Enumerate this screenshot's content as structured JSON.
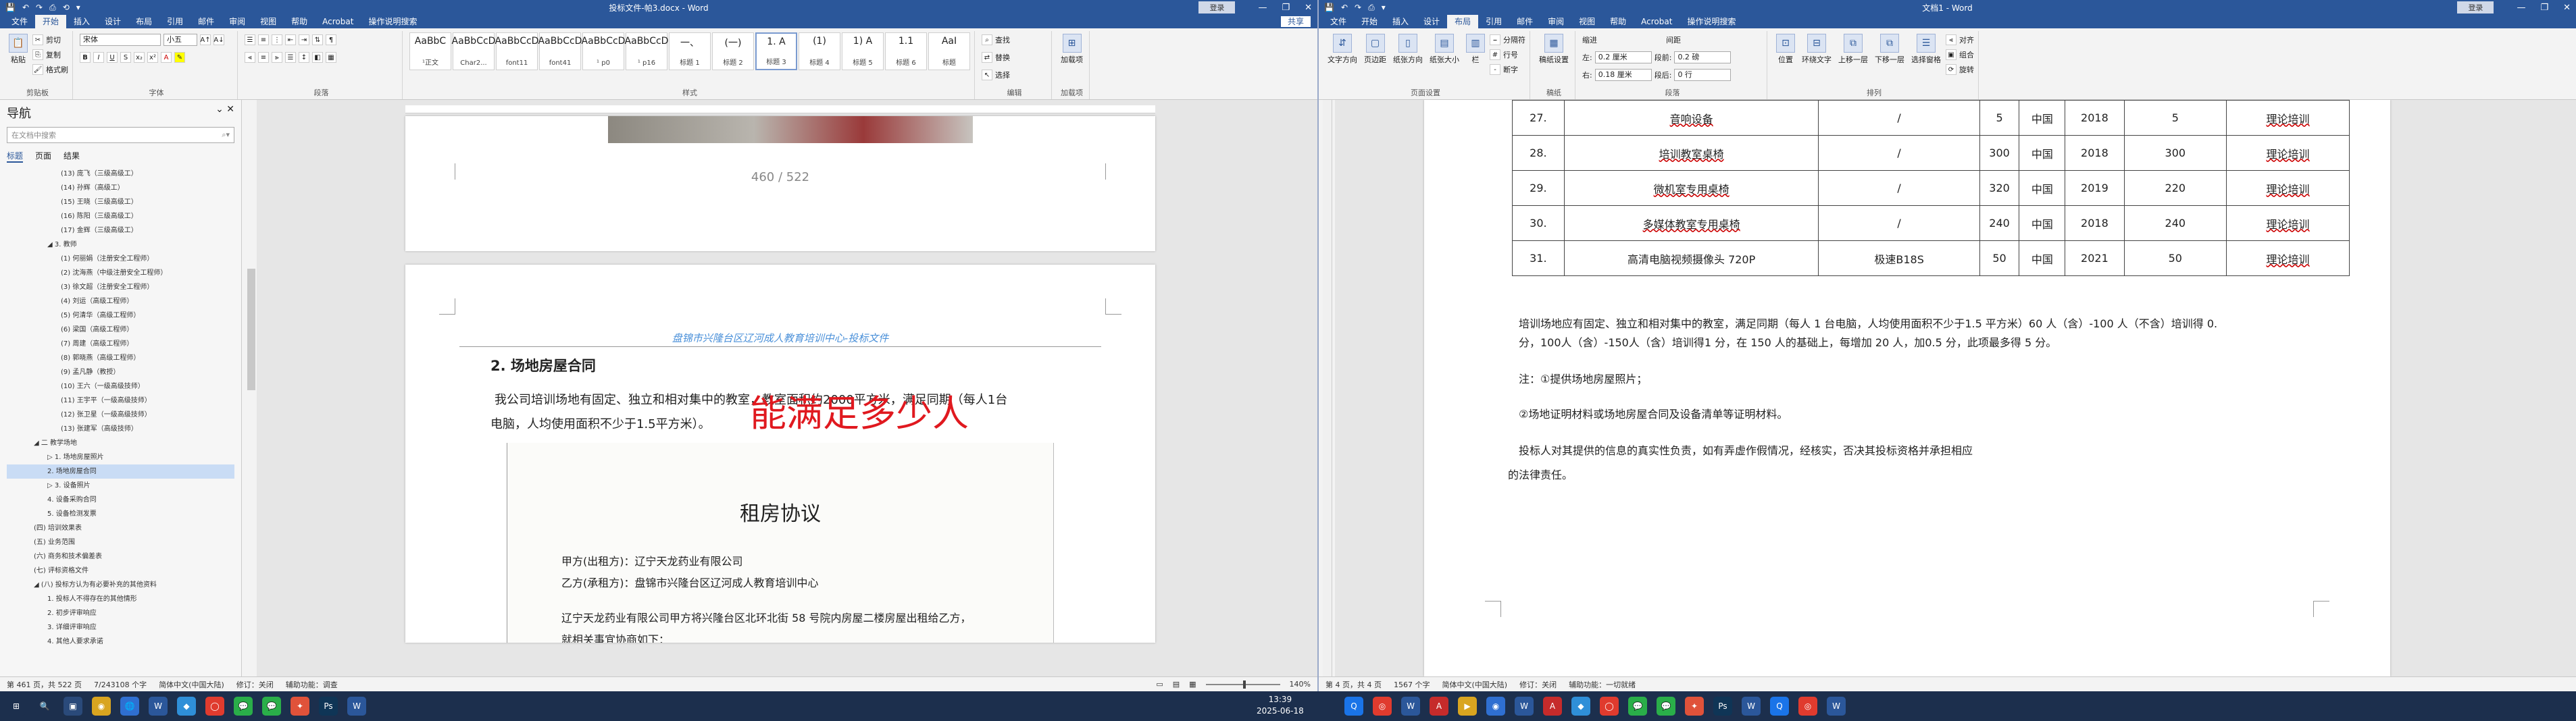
{
  "left": {
    "title": "投标文件-帕3.docx - Word",
    "quick_access": [
      "💾",
      "↶",
      "↷",
      "⎙",
      "⟲",
      "▾"
    ],
    "signin": "登录",
    "win_ctl": [
      "—",
      "❐",
      "✕"
    ],
    "tabs": [
      "文件",
      "开始",
      "插入",
      "设计",
      "布局",
      "引用",
      "邮件",
      "审阅",
      "视图",
      "帮助",
      "Acrobat",
      "操作说明搜索"
    ],
    "active_tab": "开始",
    "share": "共享",
    "ribbon": {
      "clipboard_label": "剪贴板",
      "paste": "粘贴",
      "cut": "剪切",
      "copy": "复制",
      "format_painter": "格式刷",
      "font_label": "字体",
      "font_name": "宋体",
      "font_size": "小五",
      "paragraph_label": "段落",
      "styles_label": "样式",
      "editing_label": "编辑",
      "find": "查找",
      "replace": "替换",
      "select": "选择",
      "addins_label": "加载项",
      "addins": "加载项",
      "styles": [
        {
          "preview": "AaBbC",
          "name": "¹正文"
        },
        {
          "preview": "AaBbCcD",
          "name": "Char2..."
        },
        {
          "preview": "AaBbCcD",
          "name": "font11"
        },
        {
          "preview": "AaBbCcD",
          "name": "font41"
        },
        {
          "preview": "AaBbCcD",
          "name": "¹ p0"
        },
        {
          "preview": "AaBbCcD",
          "name": "¹ p16"
        },
        {
          "preview": "一、",
          "name": "标题 1"
        },
        {
          "preview": "(一)",
          "name": "标题 2"
        },
        {
          "preview": "1. A",
          "name": "标题 3"
        },
        {
          "preview": "(1)",
          "name": "标题 4"
        },
        {
          "preview": "1) A",
          "name": "标题 5"
        },
        {
          "preview": "1.1",
          "name": "标题 6"
        },
        {
          "preview": "AaI",
          "name": "标题"
        }
      ]
    },
    "nav": {
      "title": "导航",
      "search_placeholder": "在文档中搜索",
      "tabs": [
        "标题",
        "页面",
        "结果"
      ],
      "items": [
        {
          "text": "(13) 庞飞（三级高级工）",
          "indent": 2
        },
        {
          "text": "(14) 孙辉（高级工）",
          "indent": 2
        },
        {
          "text": "(15) 王晓（三级高级工）",
          "indent": 2
        },
        {
          "text": "(16) 陈阳（三级高级工）",
          "indent": 2
        },
        {
          "text": "(17) 金辉（三级高级工）",
          "indent": 2
        },
        {
          "text": "◢ 3. 教师",
          "indent": 1
        },
        {
          "text": "(1) 何丽娟（注册安全工程师）",
          "indent": 2
        },
        {
          "text": "(2) 沈海燕（中级注册安全工程师）",
          "indent": 2
        },
        {
          "text": "(3) 徐文超（注册安全工程师）",
          "indent": 2
        },
        {
          "text": "(4) 刘运（高级工程师）",
          "indent": 2
        },
        {
          "text": "(5) 何清华（高级工程师）",
          "indent": 2
        },
        {
          "text": "(6) 梁国（高级工程师）",
          "indent": 2
        },
        {
          "text": "(7) 周建（高级工程师）",
          "indent": 2
        },
        {
          "text": "(8) 郭晓燕（高级工程师）",
          "indent": 2
        },
        {
          "text": "(9) 孟凡静（教授）",
          "indent": 2
        },
        {
          "text": "(10) 王六（一级高级技师）",
          "indent": 2
        },
        {
          "text": "(11) 王宇平（一级高级技师）",
          "indent": 2
        },
        {
          "text": "(12) 张卫星（一级高级技师）",
          "indent": 2
        },
        {
          "text": "(13) 张建军（高级技师）",
          "indent": 2
        },
        {
          "text": "◢ 二 教学场地",
          "indent": 0
        },
        {
          "text": "▷ 1. 场地房屋照片",
          "indent": 1
        },
        {
          "text": "2. 场地房屋合同",
          "indent": 1,
          "selected": true
        },
        {
          "text": "▷ 3. 设备照片",
          "indent": 1
        },
        {
          "text": "4. 设备采购合同",
          "indent": 1
        },
        {
          "text": "5. 设备检测发票",
          "indent": 1
        },
        {
          "text": "(四) 培训效果表",
          "indent": 0
        },
        {
          "text": "(五) 业务范围",
          "indent": 0
        },
        {
          "text": "(六) 商务和技术偏差表",
          "indent": 0
        },
        {
          "text": "(七) 评标资格文件",
          "indent": 0
        },
        {
          "text": "◢ (八) 投标方认为有必要补充的其他资料",
          "indent": 0
        },
        {
          "text": "1. 投标人不得存在的其他情形",
          "indent": 1
        },
        {
          "text": "2. 初步评审响应",
          "indent": 1
        },
        {
          "text": "3. 详细评审响应",
          "indent": 1
        },
        {
          "text": "4. 其他人要求承诺",
          "indent": 1
        }
      ]
    },
    "doc": {
      "page_number": "460 / 522",
      "header_text": "盘锦市兴隆台区辽河成人教育培训中心-投标文件",
      "heading": "2.  场地房屋合同",
      "para1": "我公司培训场地有固定、独立和相对集中的教室，教室面积约2000平方米，满足同期（每人1台",
      "para2": "电脑，人均使用面积不少于1.5平方米）。",
      "annotation": "能满足多少人",
      "scan_title": "租房协议",
      "party_a": "甲方(出租方)：辽宁天龙药业有限公司",
      "party_b": "乙方(承租方)：盘锦市兴隆台区辽河成人教育培训中心",
      "scan_body1": "辽宁天龙药业有限公司甲方将兴隆台区北环北街 58 号院内房屋二楼房屋出租给乙方，",
      "scan_body2": "就相关事宜协商如下："
    },
    "status": {
      "page": "第 461 页，共 522 页",
      "words": "7/243108 个字",
      "lang": "简体中文(中国大陆)",
      "track": "修订：关闭",
      "access": "辅助功能：调查",
      "zoom": "140%"
    }
  },
  "right": {
    "title": "文档1 - Word",
    "quick_access": [
      "💾",
      "↶",
      "↷",
      "⎙",
      "▾"
    ],
    "signin": "登录",
    "win_ctl": [
      "—",
      "❐",
      "✕"
    ],
    "tabs": [
      "文件",
      "开始",
      "插入",
      "设计",
      "布局",
      "引用",
      "邮件",
      "审阅",
      "视图",
      "帮助",
      "Acrobat",
      "操作说明搜索"
    ],
    "active_tab": "布局",
    "ribbon": {
      "page_setup_label": "页面设置",
      "text_direction": "文字方向",
      "margins": "页边距",
      "orientation": "纸张方向",
      "size": "纸张大小",
      "columns": "栏",
      "breaks": "分隔符",
      "line_numbers": "行号",
      "hyphenation": "断字",
      "draft_label": "稿纸",
      "draft": "稿纸设置",
      "paragraph_label": "段落",
      "indent": "缩进",
      "spacing": "间距",
      "indent_left_label": "左:",
      "indent_left": "0.2 厘米",
      "indent_right_label": "右:",
      "indent_right": "0.18 厘米",
      "space_before_label": "段前:",
      "space_before": "0.2 磅",
      "space_after_label": "段后:",
      "space_after": "0 行",
      "arrange_label": "排列",
      "position": "位置",
      "wrap": "环绕文字",
      "forward": "上移一层",
      "backward": "下移一层",
      "selection_pane": "选择窗格",
      "align": "对齐",
      "group": "组合",
      "rotate": "旋转"
    },
    "table": [
      {
        "no": "27.",
        "name": "音响设备",
        "model": "/",
        "qty": "5",
        "origin": "中国",
        "year": "2018",
        "count": "5",
        "use": "理论培训"
      },
      {
        "no": "28.",
        "name": "培训教室桌椅",
        "model": "/",
        "qty": "300",
        "origin": "中国",
        "year": "2018",
        "count": "300",
        "use": "理论培训"
      },
      {
        "no": "29.",
        "name": "微机室专用桌椅",
        "model": "/",
        "qty": "320",
        "origin": "中国",
        "year": "2019",
        "count": "220",
        "use": "理论培训"
      },
      {
        "no": "30.",
        "name": "多媒体教室专用桌椅",
        "model": "/",
        "qty": "240",
        "origin": "中国",
        "year": "2018",
        "count": "240",
        "use": "理论培训"
      },
      {
        "no": "31.",
        "name": "高清电脑视频摄像头 720P",
        "model": "极速B18S",
        "qty": "50",
        "origin": "中国",
        "year": "2021",
        "count": "50",
        "use": "理论培训"
      }
    ],
    "doc": {
      "p1": "培训场地应有固定、独立和相对集中的教室，满足同期（每人 1 台电脑，人均使用面积不少于1.5 平方米）60 人（含）-100 人（不含）培训得 0.",
      "p2": "分，100人（含）-150人（含）培训得1 分，在 150 人的基础上，每增加 20 人，加0.5 分，此项最多得 5 分。",
      "p3": "注：①提供场地房屋照片；",
      "p4": "②场地证明材料或场地房屋合同及设备清单等证明材料。",
      "p5": "投标人对其提供的信息的真实性负责，如有弄虚作假情况，经核实，否决其投标资格并承担相应",
      "p6": "的法律责任。"
    },
    "status": {
      "page": "第 4 页，共 4 页",
      "words": "1567 个字",
      "lang": "简体中文(中国大陆)",
      "track": "修订：关闭",
      "access": "辅助功能：一切就绪"
    }
  },
  "taskbar": {
    "time": "13:39",
    "date": "2025-06-18",
    "apps": [
      {
        "glyph": "⊞",
        "color": "#1c2f4d"
      },
      {
        "glyph": "🔍",
        "color": "#1c2f4d"
      },
      {
        "glyph": "▣",
        "color": "#2a4a7a"
      },
      {
        "glyph": "◉",
        "color": "#d9a520"
      },
      {
        "glyph": "🌐",
        "color": "#2f6fd1"
      },
      {
        "glyph": "W",
        "color": "#2b579a"
      },
      {
        "glyph": "◆",
        "color": "#2f8fd8"
      },
      {
        "glyph": "◯",
        "color": "#e03b2e"
      },
      {
        "glyph": "💬",
        "color": "#2aae49"
      },
      {
        "glyph": "💬",
        "color": "#2aae49"
      },
      {
        "glyph": "✦",
        "color": "#e0523a"
      },
      {
        "glyph": "Ps",
        "color": "#0f3556"
      },
      {
        "glyph": "W",
        "color": "#2b579a"
      }
    ],
    "apps_right": [
      {
        "glyph": "Q",
        "color": "#1a74e8"
      },
      {
        "glyph": "◎",
        "color": "#e03b2e"
      },
      {
        "glyph": "W",
        "color": "#2b579a"
      },
      {
        "glyph": "A",
        "color": "#c62b2b"
      },
      {
        "glyph": "▶",
        "color": "#d9a520"
      },
      {
        "glyph": "◉",
        "color": "#2f6fd1"
      },
      {
        "glyph": "W",
        "color": "#2b579a"
      },
      {
        "glyph": "A",
        "color": "#c62b2b"
      },
      {
        "glyph": "◆",
        "color": "#2f8fd8"
      },
      {
        "glyph": "◯",
        "color": "#e03b2e"
      },
      {
        "glyph": "💬",
        "color": "#2aae49"
      },
      {
        "glyph": "💬",
        "color": "#2aae49"
      },
      {
        "glyph": "✦",
        "color": "#e0523a"
      },
      {
        "glyph": "Ps",
        "color": "#0f3556"
      },
      {
        "glyph": "W",
        "color": "#2b579a"
      },
      {
        "glyph": "Q",
        "color": "#1a74e8"
      },
      {
        "glyph": "◎",
        "color": "#e03b2e"
      },
      {
        "glyph": "W",
        "color": "#2b579a"
      }
    ]
  }
}
